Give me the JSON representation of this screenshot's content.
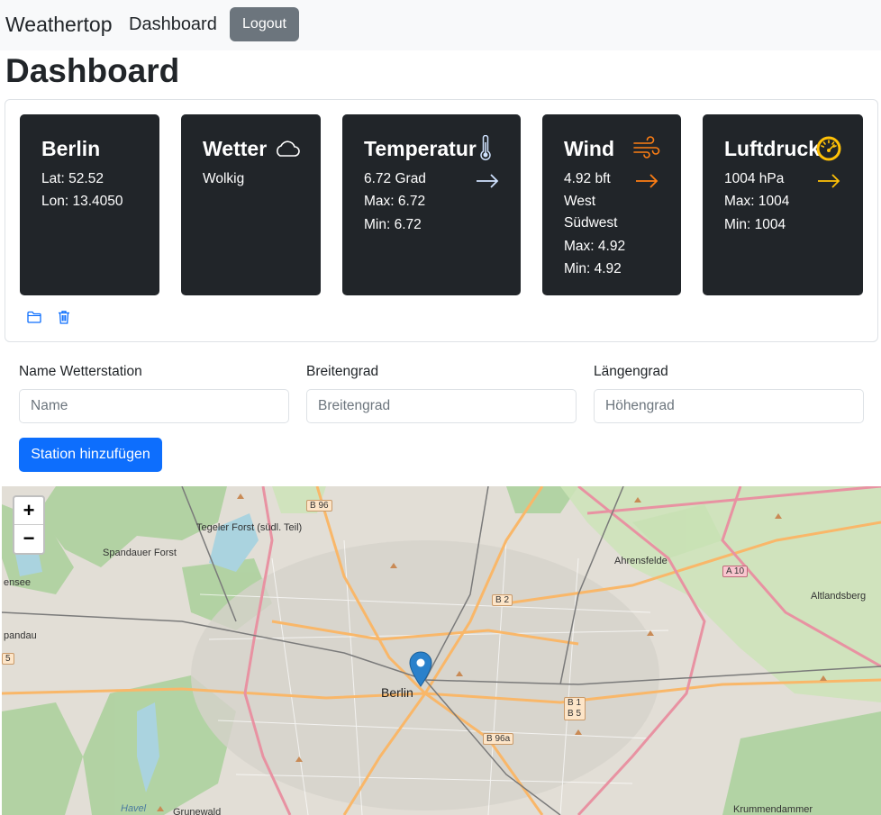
{
  "nav": {
    "brand": "Weathertop",
    "dashboard_link": "Dashboard",
    "logout_label": "Logout"
  },
  "page_title": "Dashboard",
  "station": {
    "name": "Berlin",
    "lat": "Lat: 52.52",
    "lon": "Lon: 13.4050"
  },
  "cards": {
    "weather": {
      "title": "Wetter",
      "text": "Wolkig",
      "icon": "cloud-icon"
    },
    "temperature": {
      "title": "Temperatur",
      "value": "6.72 Grad",
      "max": "Max: 6.72",
      "min": "Min: 6.72",
      "icon": "thermometer-icon",
      "arrow": "arrow-right-icon",
      "color": "#cfe2ff"
    },
    "wind": {
      "title": "Wind",
      "value": "4.92 bft",
      "dir1": "West",
      "dir2": "Südwest",
      "max": "Max: 4.92",
      "min": "Min: 4.92",
      "icon": "wind-icon",
      "arrow": "arrow-right-icon",
      "color": "#fd7e14"
    },
    "pressure": {
      "title": "Luftdruck",
      "value": "1004 hPa",
      "max": "Max: 1004",
      "min": "Min: 1004",
      "icon": "speedometer-icon",
      "arrow": "arrow-right-icon",
      "color": "#ffc107"
    }
  },
  "actions": {
    "open_icon": "folder-icon",
    "delete_icon": "trash-icon"
  },
  "form": {
    "name_label": "Name Wetterstation",
    "name_placeholder": "Name",
    "lat_label": "Breitengrad",
    "lat_placeholder": "Breitengrad",
    "lon_label": "Längengrad",
    "lon_placeholder": "Höhengrad",
    "submit_label": "Station hinzufügen"
  },
  "map": {
    "zoom_in": "+",
    "zoom_out": "−",
    "labels": {
      "berlin": "Berlin",
      "ahrensfelde": "Ahrensfelde",
      "altlandsberg": "Altlandsberg",
      "tegeler_forst": "Tegeler Forst (südl. Teil)",
      "spandauer_forst": "Spandauer Forst",
      "ensee": "ensee",
      "pandau": "pandau",
      "havel": "Havel",
      "grunewald": "Grunewald",
      "krummendammer": "Krummendammer"
    },
    "shields": {
      "b96": "B 96",
      "b2": "B 2",
      "a10": "A 10",
      "b1b5": "B 1 B 5",
      "b96a": "B 96a",
      "five": "5"
    },
    "colors": {
      "primary": "#0d6efd",
      "marker": "#2a81cb"
    }
  }
}
